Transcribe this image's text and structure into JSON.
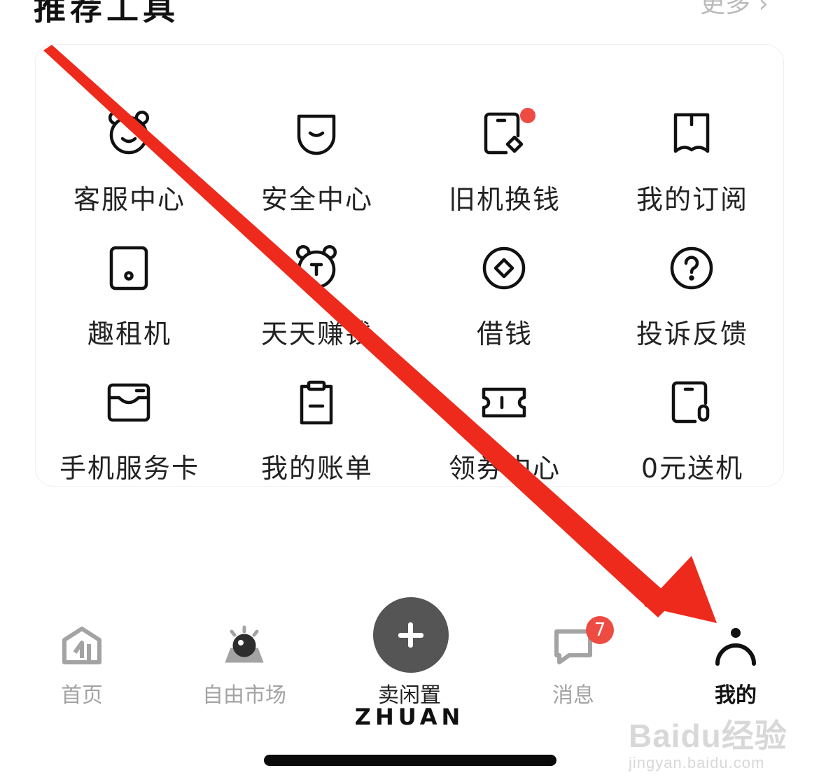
{
  "section": {
    "title": "推荐工具",
    "more_label": "更多 ›"
  },
  "tools": [
    {
      "label": "客服中心",
      "icon": "bear-face-icon"
    },
    {
      "label": "安全中心",
      "icon": "shield-smile-icon"
    },
    {
      "label": "旧机换钱",
      "icon": "phone-trade-icon",
      "has_dot": true
    },
    {
      "label": "我的订阅",
      "icon": "bookmark-icon"
    },
    {
      "label": "趣租机",
      "icon": "tablet-icon"
    },
    {
      "label": "天天赚钱",
      "icon": "bear-coin-icon"
    },
    {
      "label": "借钱",
      "icon": "diamond-coin-icon"
    },
    {
      "label": "投诉反馈",
      "icon": "question-circle-icon"
    },
    {
      "label": "手机服务卡",
      "icon": "card-tray-icon"
    },
    {
      "label": "我的账单",
      "icon": "clipboard-icon"
    },
    {
      "label": "领券中心",
      "icon": "ticket-icon"
    },
    {
      "label": "0元送机",
      "icon": "phone-zero-icon"
    }
  ],
  "tabbar": {
    "home": {
      "label": "首页",
      "icon": "home-icon"
    },
    "market": {
      "label": "自由市场",
      "icon": "alarm-light-icon"
    },
    "sell": {
      "label": "卖闲置",
      "icon": "plus-icon"
    },
    "messages": {
      "label": "消息",
      "icon": "chat-bubble-icon",
      "badge": "7"
    },
    "profile": {
      "label": "我的",
      "icon": "person-icon"
    }
  },
  "brand": "ZHUAN",
  "watermark": {
    "main": "Baidu经验",
    "sub": "jingyan.baidu.com"
  },
  "colors": {
    "arrow": "#ee2a1c",
    "badge": "#ee4b43",
    "active": "#111111",
    "inactive": "#a3a3a3"
  }
}
